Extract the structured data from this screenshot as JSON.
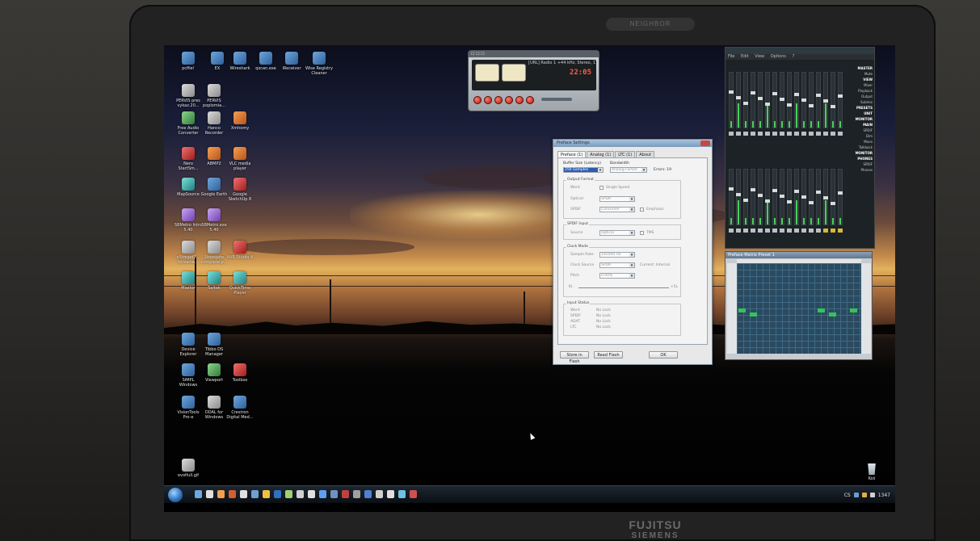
{
  "bezel": {
    "top_logo": "NEIGHBOR",
    "brand_top": "FUJITSU",
    "brand_bottom": "SIEMENS"
  },
  "desktop_icons": [
    {
      "label": "pcfile!",
      "color": "blue"
    },
    {
      "label": "EX",
      "color": "blue"
    },
    {
      "label": "Wireshark",
      "color": "blue"
    },
    {
      "label": "qxcan.exe",
      "color": "blue"
    },
    {
      "label": "iReceiver",
      "color": "blue"
    },
    {
      "label": "Wise Registry\nCleaner",
      "color": "blue"
    },
    {
      "label": "PERVIS pres\nvykaz.20...",
      "color": "gray"
    },
    {
      "label": "PERVIS\npoplomia...",
      "color": "gray"
    },
    {
      "label": "Free Audio\nConverter",
      "color": "green"
    },
    {
      "label": "Hanco\nRecorder",
      "color": "gray"
    },
    {
      "label": "Xmhomy",
      "color": "orange"
    },
    {
      "label": "Nero\nStartSm...",
      "color": "red"
    },
    {
      "label": "ABMP2",
      "color": "orange"
    },
    {
      "label": "VLC media\nplayer",
      "color": "orange"
    },
    {
      "label": "MapSource",
      "color": "teal"
    },
    {
      "label": "Google Earth",
      "color": "blue"
    },
    {
      "label": "Google\nSketchUp 8",
      "color": "red"
    },
    {
      "label": "SBMetro Intro\n5.40",
      "color": "purple"
    },
    {
      "label": "SBMetro.exe\n5.40",
      "color": "purple"
    },
    {
      "label": "xStreget2...\nStreame...",
      "color": "gray"
    },
    {
      "label": "Streegate\ncomplete.p...",
      "color": "gray"
    },
    {
      "label": "AVR Studio 4",
      "color": "red"
    },
    {
      "label": "Maxtor",
      "color": "teal"
    },
    {
      "label": "Saitek",
      "color": "teal"
    },
    {
      "label": "QuickTime\nPlayer",
      "color": "teal"
    },
    {
      "label": "Device\nExplorer",
      "color": "blue"
    },
    {
      "label": "Tibbo DS\nManager",
      "color": "blue"
    },
    {
      "label": "SIMPL\nWindows",
      "color": "blue"
    },
    {
      "label": "Viewport",
      "color": "green"
    },
    {
      "label": "Toolbox",
      "color": "red"
    },
    {
      "label": "VisionTools\nPro-e",
      "color": "blue"
    },
    {
      "label": "DDAL for\nWindows",
      "color": "gray"
    },
    {
      "label": "Crestron\nDigital Med...",
      "color": "blue"
    },
    {
      "label": "evolfull.gif",
      "color": "gray"
    },
    {
      "label": "Koš",
      "color": "gray"
    }
  ],
  "player": {
    "title": "☐ ☐ ☐",
    "stream_info": "[URL] Radio 1 +44 kHz, Stereo, 1",
    "time": "22:05",
    "buttons": [
      "prev",
      "play",
      "pause",
      "stop",
      "next",
      "eject"
    ]
  },
  "mixer": {
    "title": "",
    "menu": [
      "File",
      "Edit",
      "View",
      "Options",
      "?"
    ],
    "side_panel": [
      "MASTER",
      "Mute",
      "VIEW",
      "Mixer",
      "Playback",
      "Output",
      "Submix",
      "PRESETS",
      "UNIT",
      "MONITOR MAIN",
      "SPDIF",
      "Dim",
      "Mono",
      "Talkback",
      "MONITOR PHONES",
      "SPDIF",
      "Phones"
    ]
  },
  "matrix": {
    "title": "Preface Matrix    Preset 1"
  },
  "dialog": {
    "title": "Preface Settings",
    "tabs": [
      "Preface (1)",
      "Analog (1)",
      "LTC (1)",
      "About"
    ],
    "buffer_label": "Buffer Size (Latency)",
    "buffer_value": "256 Samples",
    "bandwidth_label": "Bandwidth",
    "bandwidth_value": "Analog+SPDIF",
    "errors": "Errors: 19",
    "output_format": {
      "legend": "Output Format",
      "wordclock_label": "Word",
      "single_speed": "Single Speed",
      "optical_label": "Optical",
      "optical_value": "SPDIF",
      "spdif_label": "SPDIF",
      "spdif_value": "Consumer",
      "emphasis": "Emphasis"
    },
    "spdif_input": {
      "legend": "SPDIF Input",
      "source_label": "Source",
      "source_value": "Optical",
      "tms": "TMS"
    },
    "clock_mode": {
      "legend": "Clock Mode",
      "sample_rate_label": "Sample Rate",
      "sample_rate_value": "192000 Hz",
      "clock_source_label": "Clock Source",
      "clock_source_value": "SPDIF",
      "current": "Current: Internal",
      "pitch_label": "Pitch",
      "pitch_value": "0.00%",
      "slider_left": "Kl.",
      "slider_right": "+5L"
    },
    "input_status": {
      "legend": "Input Status",
      "rows": [
        {
          "name": "Word",
          "value": "No Lock"
        },
        {
          "name": "SPDIF",
          "value": "No Lock"
        },
        {
          "name": "ADAT",
          "value": "No Lock"
        },
        {
          "name": "LTC",
          "value": "No Lock"
        }
      ]
    },
    "buttons": {
      "store": "Store in Flash",
      "read": "Read Flash",
      "ok": "OK"
    }
  },
  "taskbar": {
    "lang": "CS",
    "clock": "1347"
  }
}
